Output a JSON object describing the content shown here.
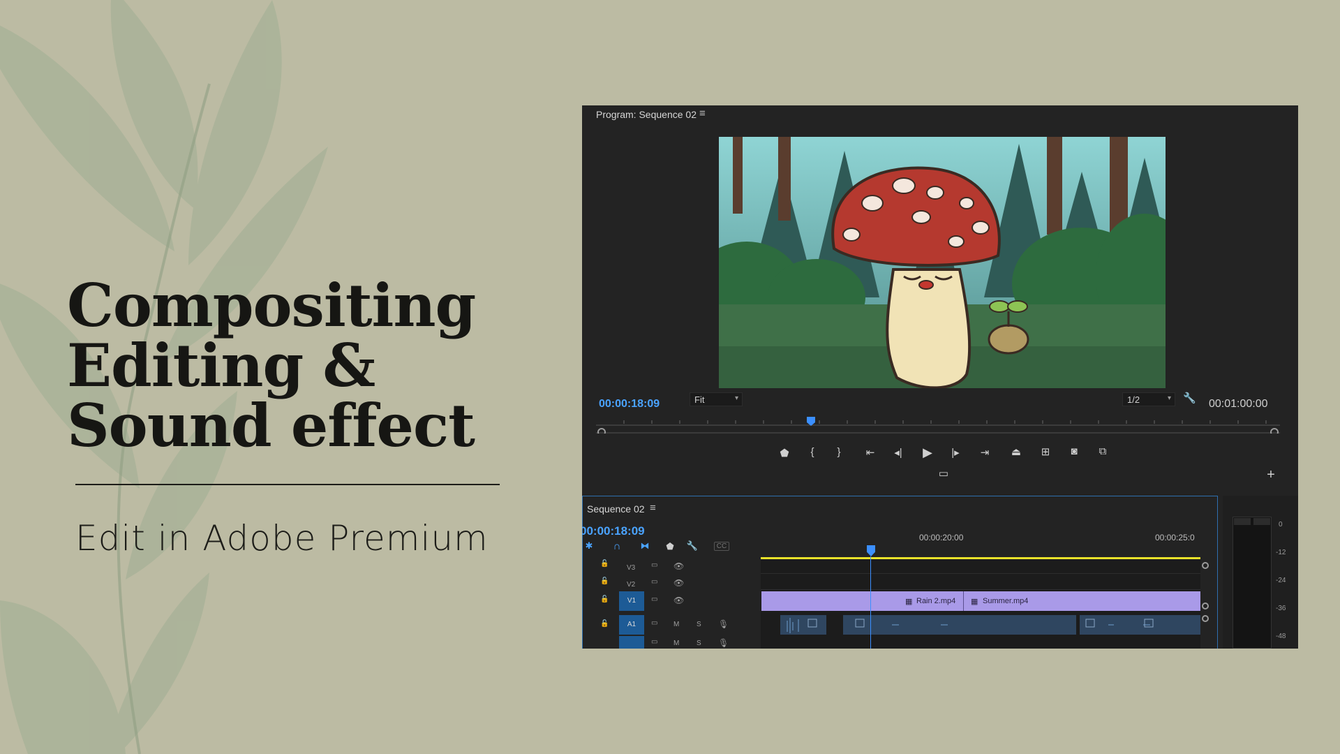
{
  "headline": {
    "line1": "Compositing",
    "line2": "Editing &",
    "line3": "Sound effect"
  },
  "subtitle": "Edit in Adobe Premium",
  "program_monitor": {
    "title": "Program: Sequence 02",
    "current_time": "00:00:18:09",
    "zoom_select": "Fit",
    "resolution_select": "1/2",
    "duration": "00:01:00:00"
  },
  "sequence": {
    "title": "Sequence 02",
    "current_time": "00:00:18:09",
    "ruler_times": [
      "00:00:20:00",
      "00:00:25:0"
    ],
    "tracks": {
      "v3": "V3",
      "v2": "V2",
      "v1": "V1",
      "a1": "A1",
      "mute": "M",
      "solo": "S"
    },
    "clips": [
      "Rain 2.mp4",
      "Summer.mp4"
    ]
  },
  "audio_meter": {
    "scale": [
      "0",
      "-12",
      "-24",
      "-36",
      "-48"
    ]
  },
  "colors": {
    "background": "#bcbba3",
    "accent_blue": "#4aa3ff",
    "clip_purple": "#a99ae8",
    "work_area_yellow": "#e8e22a"
  }
}
